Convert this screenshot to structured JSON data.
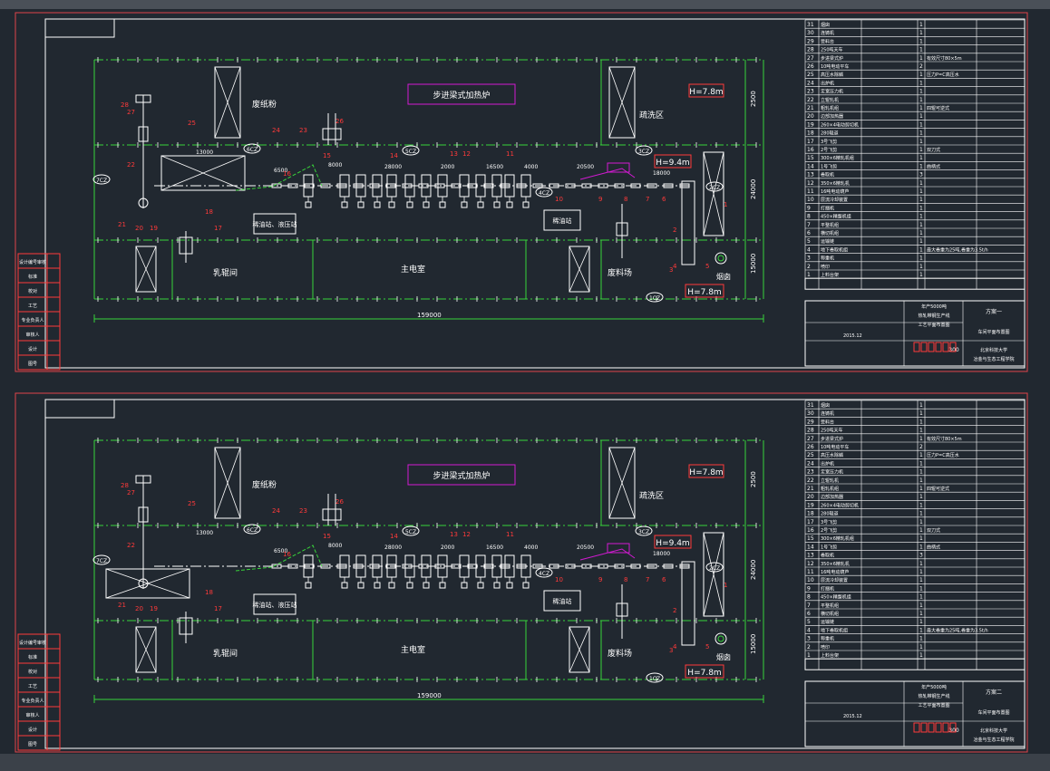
{
  "colors": {
    "background": "#212830",
    "frame": "#e0454a",
    "sheet": "#ffffff",
    "grid": "#38d43a",
    "equipment": "#ffffff",
    "callout": "#ff3a3a",
    "title_box": "#d21ad2",
    "label": "#ffffff"
  },
  "sheets": [
    {
      "areas": {
        "scrap": "废纸粉",
        "rolling": "乳辊间",
        "motor": "主电室",
        "deposit": "废料场",
        "descaling": "疏洗区",
        "oil": "稀油站、液压站",
        "pump": "稀油站",
        "chimney": "烟囱"
      },
      "furnace": "步进梁式加热炉",
      "heights": [
        "H=7.8m",
        "H=9.4m",
        "H=7.8m"
      ],
      "cranes": [
        "6CZ",
        "5CZ",
        "3CZ",
        "4CZ",
        "2CZ",
        "1CZ",
        "7CZ"
      ],
      "dims": {
        "top": "2500",
        "mid": "24000",
        "low": "15000",
        "total": "159000",
        "d1": "13000",
        "d2": "28000",
        "d3": "15000",
        "d4": "3500",
        "d5": "6500",
        "d6": "8000",
        "d7": "21000",
        "d8": "16500",
        "d9": "4000",
        "d10": "20500",
        "d11": "18000",
        "d12": "2000",
        "d13": "18000"
      },
      "callouts": [
        "28",
        "27",
        "26",
        "25",
        "24",
        "23",
        "22",
        "21",
        "20",
        "19",
        "18",
        "17",
        "16",
        "15",
        "14",
        "13",
        "12",
        "11",
        "10",
        "9",
        "8",
        "7",
        "6",
        "5",
        "4",
        "3",
        "2",
        "1"
      ],
      "title_block": {
        "version": "方案一",
        "project": "年产5000吨",
        "project2": "热轧带钢生产线",
        "project3": "工艺平面布置图",
        "drawing": "车间平面布置图",
        "school": "北京科技大学",
        "school2": "冶金与生态工程学院",
        "scale": "300",
        "date": "2015.12"
      }
    },
    {
      "areas": {
        "scrap": "废纸粉",
        "rolling": "乳辊间",
        "motor": "主电室",
        "deposit": "废料场",
        "descaling": "疏洗区",
        "oil": "稀油站、液压站",
        "pump": "稀油站",
        "chimney": "烟囱"
      },
      "furnace": "步进梁式加热炉",
      "heights": [
        "H=7.8m",
        "H=9.4m",
        "H=7.8m"
      ],
      "cranes": [
        "6CZ",
        "5CZ",
        "3CZ",
        "4CZ",
        "2CZ",
        "1CZ",
        "7CZ"
      ],
      "dims": {
        "top": "2500",
        "mid": "24000",
        "low": "15000",
        "total": "159000",
        "d1": "13000",
        "d2": "28000",
        "d3": "15000",
        "d4": "3500",
        "d5": "6500",
        "d6": "8000",
        "d7": "21000",
        "d8": "16500",
        "d9": "4000",
        "d10": "20500",
        "d11": "18000",
        "d12": "2000",
        "d13": "18000"
      },
      "callouts": [
        "28",
        "27",
        "26",
        "25",
        "24",
        "23",
        "22",
        "21",
        "20",
        "19",
        "18",
        "17",
        "16",
        "15",
        "14",
        "13",
        "12",
        "11",
        "10",
        "9",
        "8",
        "7",
        "6",
        "5",
        "4",
        "3",
        "2",
        "1"
      ],
      "title_block": {
        "version": "方案二",
        "project": "年产5000吨",
        "project2": "热轧带钢生产线",
        "project3": "工艺平面布置图",
        "drawing": "车间平面布置图",
        "school": "北京科技大学",
        "school2": "冶金与生态工程学院",
        "scale": "300",
        "date": "2015.12"
      }
    }
  ],
  "parts_list": [
    {
      "no": "31",
      "name": "烟囱",
      "qty": "1",
      "note": ""
    },
    {
      "no": "30",
      "name": "连铸机",
      "qty": "1",
      "note": ""
    },
    {
      "no": "29",
      "name": "受料台",
      "qty": "1",
      "note": ""
    },
    {
      "no": "28",
      "name": "250吨天车",
      "qty": "1",
      "note": ""
    },
    {
      "no": "27",
      "name": "步进梁式炉",
      "qty": "1",
      "note": "有效尺寸80×5m"
    },
    {
      "no": "26",
      "name": "10吨电动平车",
      "qty": "2",
      "note": ""
    },
    {
      "no": "25",
      "name": "高压水除鳞",
      "qty": "1",
      "note": "压力P=C高压水"
    },
    {
      "no": "24",
      "name": "出炉机",
      "qty": "1",
      "note": ""
    },
    {
      "no": "23",
      "name": "定宽压力机",
      "qty": "1",
      "note": ""
    },
    {
      "no": "22",
      "name": "立辊轧机",
      "qty": "1",
      "note": ""
    },
    {
      "no": "21",
      "name": "粗轧机组",
      "qty": "1",
      "note": "四辊可逆式"
    },
    {
      "no": "20",
      "name": "边部加热器",
      "qty": "1",
      "note": ""
    },
    {
      "no": "19",
      "name": "260×4电动剪切机",
      "qty": "1",
      "note": ""
    },
    {
      "no": "18",
      "name": "280辊道",
      "qty": "1",
      "note": ""
    },
    {
      "no": "17",
      "name": "3号飞剪",
      "qty": "1",
      "note": ""
    },
    {
      "no": "16",
      "name": "2号飞剪",
      "qty": "1",
      "note": "双刀式"
    },
    {
      "no": "15",
      "name": "300×6精轧机组",
      "qty": "1",
      "note": ""
    },
    {
      "no": "14",
      "name": "1号飞剪",
      "qty": "1",
      "note": "曲柄式"
    },
    {
      "no": "13",
      "name": "卷取机",
      "qty": "3",
      "note": ""
    },
    {
      "no": "12",
      "name": "350×6精轧机",
      "qty": "1",
      "note": ""
    },
    {
      "no": "11",
      "name": "16吨电动葫芦",
      "qty": "1",
      "note": ""
    },
    {
      "no": "10",
      "name": "层流冷却装置",
      "qty": "1",
      "note": ""
    },
    {
      "no": "9",
      "name": "打捆机",
      "qty": "1",
      "note": ""
    },
    {
      "no": "8",
      "name": "450×精整机组",
      "qty": "1",
      "note": ""
    },
    {
      "no": "7",
      "name": "平整机组",
      "qty": "1",
      "note": ""
    },
    {
      "no": "6",
      "name": "横切机组",
      "qty": "1",
      "note": ""
    },
    {
      "no": "5",
      "name": "运输链",
      "qty": "1",
      "note": ""
    },
    {
      "no": "4",
      "name": "地下卷取机组",
      "qty": "1",
      "note": "最大卷重为25吨,卷重为3.5t/h"
    },
    {
      "no": "3",
      "name": "称重机",
      "qty": "1",
      "note": ""
    },
    {
      "no": "2",
      "name": "喷印",
      "qty": "1",
      "note": ""
    },
    {
      "no": "1",
      "name": "上料台架",
      "qty": "1",
      "note": ""
    }
  ],
  "left_stamp": [
    "设计编号审核",
    "标准",
    "校对",
    "工艺",
    "专业负责人",
    "审核人",
    "设计",
    "图号"
  ]
}
